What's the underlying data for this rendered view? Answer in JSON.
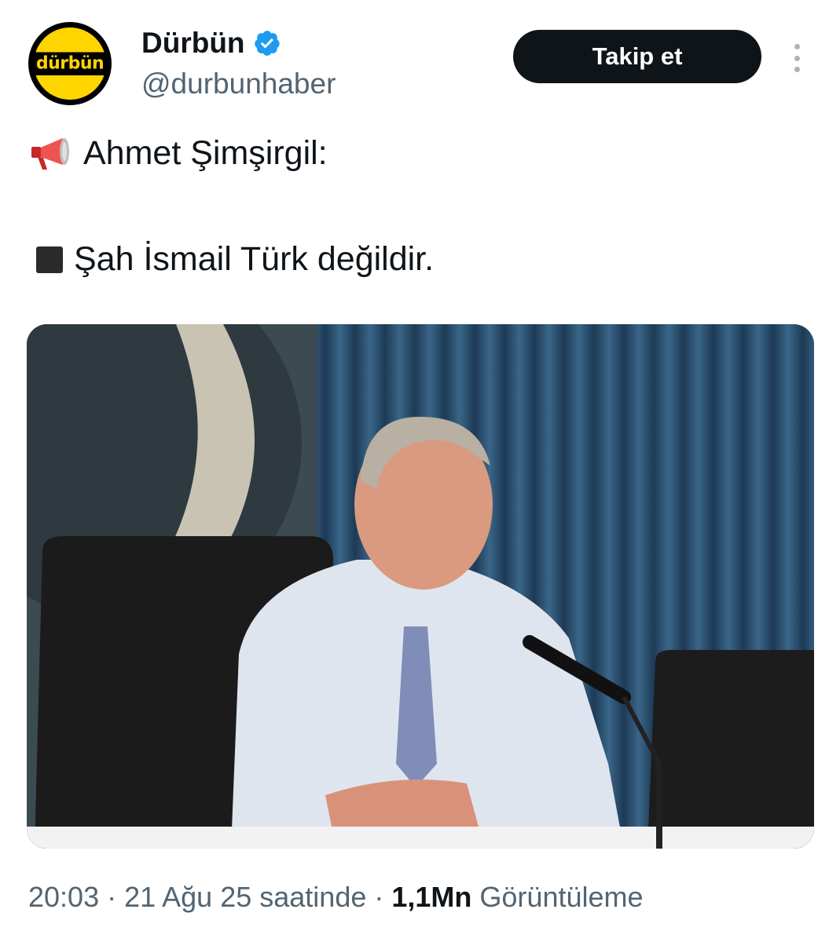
{
  "author": {
    "avatar_text": "dürbün",
    "display_name": "Dürbün",
    "handle": "@durbunhaber",
    "verified_icon": "verified-badge-icon"
  },
  "actions": {
    "follow_label": "Takip et",
    "more_icon": "more-options-icon"
  },
  "tweet": {
    "line1_emoji": "megaphone-icon",
    "line1_text": "Ahmet Şimşirgil:",
    "line2_emoji": "black-square-icon",
    "line2_text": "Şah İsmail Türk değildir."
  },
  "media": {
    "type": "photo",
    "subject": "man in white shirt and tie speaking at microphone"
  },
  "footer": {
    "time": "20:03",
    "sep1": "·",
    "date": "21 Ağu 25 saatinde",
    "sep2": "·",
    "views_count": "1,1Mn",
    "views_label": "Görüntüleme"
  },
  "colors": {
    "text_primary": "#0f1419",
    "text_secondary": "#536471",
    "verified_blue": "#1d9bf0",
    "logo_yellow": "#ffd500"
  }
}
